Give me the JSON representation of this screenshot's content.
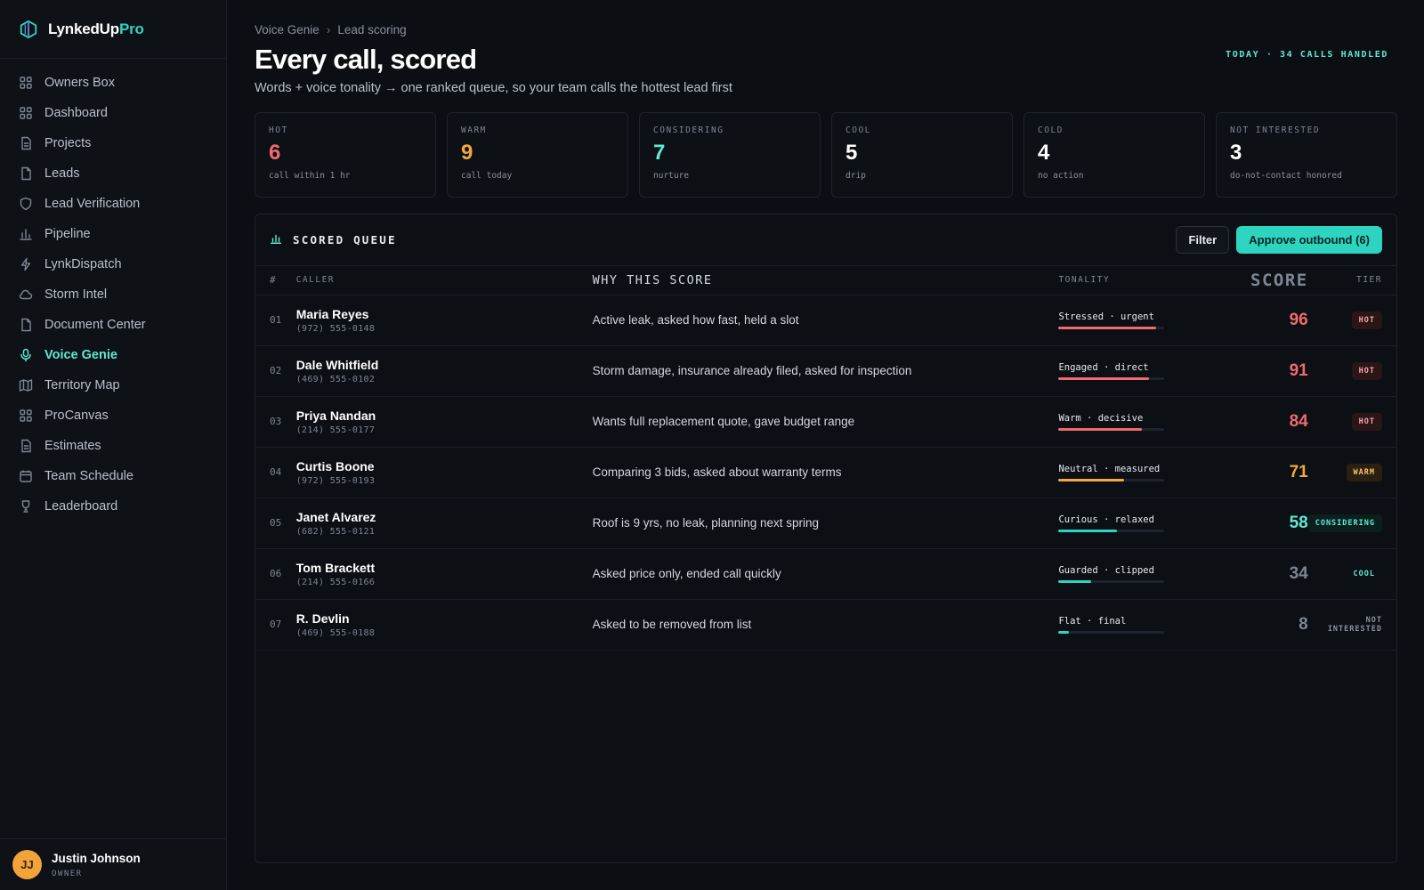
{
  "app": {
    "brand_name": "LynkedUp",
    "brand_suffix": "Pro"
  },
  "sidebar": {
    "items": [
      {
        "label": "Owners Box",
        "icon": "grid-icon"
      },
      {
        "label": "Dashboard",
        "icon": "grid-icon"
      },
      {
        "label": "Projects",
        "icon": "document-icon"
      },
      {
        "label": "Leads",
        "icon": "file-icon"
      },
      {
        "label": "Lead Verification",
        "icon": "shield-icon"
      },
      {
        "label": "Pipeline",
        "icon": "bar-chart-icon"
      },
      {
        "label": "LynkDispatch",
        "icon": "lightning-icon"
      },
      {
        "label": "Storm Intel",
        "icon": "cloud-icon"
      },
      {
        "label": "Document Center",
        "icon": "file-icon"
      },
      {
        "label": "Voice Genie",
        "icon": "microphone-icon",
        "active": true
      },
      {
        "label": "Territory Map",
        "icon": "map-icon"
      },
      {
        "label": "ProCanvas",
        "icon": "grid-icon"
      },
      {
        "label": "Estimates",
        "icon": "document-icon"
      },
      {
        "label": "Team Schedule",
        "icon": "calendar-icon"
      },
      {
        "label": "Leaderboard",
        "icon": "trophy-icon"
      }
    ],
    "user": {
      "initials": "JJ",
      "name": "Justin Johnson",
      "role": "OWNER"
    }
  },
  "header": {
    "breadcrumb": [
      "Voice Genie",
      "Lead scoring"
    ],
    "breadcrumb_sep": "›",
    "title": "Every call, scored",
    "subtitle": "Words + voice tonality → one ranked queue, so your team calls the hottest lead first",
    "today": "TODAY · 34 CALLS HANDLED"
  },
  "stats": [
    {
      "label": "HOT",
      "value": "6",
      "note": "call within 1 hr",
      "color": "#f06a6f"
    },
    {
      "label": "WARM",
      "value": "9",
      "note": "call today",
      "color": "#f2a93b"
    },
    {
      "label": "CONSIDERING",
      "value": "7",
      "note": "nurture",
      "color": "#5eead4"
    },
    {
      "label": "COOL",
      "value": "5",
      "note": "drip",
      "color": "#ffffff"
    },
    {
      "label": "COLD",
      "value": "4",
      "note": "no action",
      "color": "#ffffff"
    },
    {
      "label": "NOT INTERESTED",
      "value": "3",
      "note": "do-not-contact honored",
      "color": "#ffffff"
    }
  ],
  "queue": {
    "title": "SCORED QUEUE",
    "filter_label": "Filter",
    "approve_label": "Approve outbound (6)",
    "columns": [
      "#",
      "CALLER",
      "WHY THIS SCORE",
      "TONALITY",
      "SCORE",
      "TIER"
    ],
    "rows": [
      {
        "num": "01",
        "name": "Maria Reyes",
        "phone": "(972) 555-0148",
        "why": "Active leak, asked how fast, held a slot",
        "tonality": "Stressed · urgent",
        "tone_level": 0.92,
        "tone_color": "#f06a6f",
        "score": "96",
        "score_color": "#f06a6f",
        "tier": "HOT",
        "tier_class": "hot"
      },
      {
        "num": "02",
        "name": "Dale Whitfield",
        "phone": "(469) 555-0102",
        "why": "Storm damage, insurance already filed, asked for inspection",
        "tonality": "Engaged · direct",
        "tone_level": 0.85,
        "tone_color": "#f06a6f",
        "score": "91",
        "score_color": "#f06a6f",
        "tier": "HOT",
        "tier_class": "hot"
      },
      {
        "num": "03",
        "name": "Priya Nandan",
        "phone": "(214) 555-0177",
        "why": "Wants full replacement quote, gave budget range",
        "tonality": "Warm · decisive",
        "tone_level": 0.79,
        "tone_color": "#f06a6f",
        "score": "84",
        "score_color": "#f06a6f",
        "tier": "HOT",
        "tier_class": "hot"
      },
      {
        "num": "04",
        "name": "Curtis Boone",
        "phone": "(972) 555-0193",
        "why": "Comparing 3 bids, asked about warranty terms",
        "tonality": "Neutral · measured",
        "tone_level": 0.62,
        "tone_color": "#f2a93b",
        "score": "71",
        "score_color": "#f2a93b",
        "tier": "WARM",
        "tier_class": "warm"
      },
      {
        "num": "05",
        "name": "Janet Alvarez",
        "phone": "(682) 555-0121",
        "why": "Roof is 9 yrs, no leak, planning next spring",
        "tonality": "Curious · relaxed",
        "tone_level": 0.55,
        "tone_color": "#2dd4bf",
        "score": "58",
        "score_color": "#5eead4",
        "tier": "CONSIDERING",
        "tier_class": "considering"
      },
      {
        "num": "06",
        "name": "Tom Brackett",
        "phone": "(214) 555-0166",
        "why": "Asked price only, ended call quickly",
        "tonality": "Guarded · clipped",
        "tone_level": 0.31,
        "tone_color": "#2dd4bf",
        "score": "34",
        "score_color": "#7d8693",
        "tier": "COOL",
        "tier_class": "cool"
      },
      {
        "num": "07",
        "name": "R. Devlin",
        "phone": "(469) 555-0188",
        "why": "Asked to be removed from list",
        "tonality": "Flat · final",
        "tone_level": 0.1,
        "tone_color": "#2dd4bf",
        "score": "8",
        "score_color": "#7d8693",
        "tier": "NOT INTERESTED",
        "tier_class": "not"
      }
    ]
  }
}
